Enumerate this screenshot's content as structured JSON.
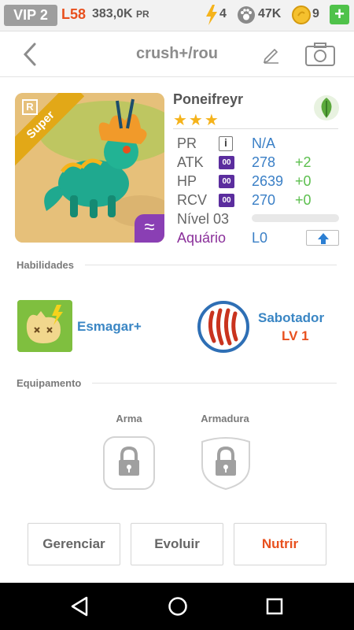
{
  "status_bar": {
    "vip": "VIP 2",
    "level": "L58",
    "pr_value": "383,0K",
    "pr_suffix": "PR",
    "energy": "4",
    "food": "47K",
    "coins": "9",
    "add_label": "+"
  },
  "header": {
    "title": "crush+/rou"
  },
  "monster": {
    "name": "Poneifreyr",
    "rarity_letter": "R",
    "tier": "Super",
    "stars": "★★★",
    "element_icon": "leaf-icon",
    "element_color": "#5aa83b",
    "stats": [
      {
        "label": "PR",
        "icon": "i",
        "value": "N/A",
        "bonus": ""
      },
      {
        "label": "ATK",
        "icon": "00",
        "value": "278",
        "bonus": "+2"
      },
      {
        "label": "HP",
        "icon": "00",
        "value": "2639",
        "bonus": "+0"
      },
      {
        "label": "RCV",
        "icon": "00",
        "value": "270",
        "bonus": "+0"
      }
    ],
    "level_label": "Nível 03",
    "aquario_label": "Aquário",
    "aquario_value": "L0"
  },
  "abilities": {
    "title": "Habilidades",
    "skill1": {
      "name": "Esmagar+"
    },
    "skill2": {
      "name": "Sabotador",
      "level": "LV 1"
    }
  },
  "equipment": {
    "title": "Equipamento",
    "weapon_label": "Arma",
    "armor_label": "Armadura"
  },
  "actions": {
    "manage": "Gerenciar",
    "evolve": "Evoluir",
    "feed": "Nutrir"
  },
  "colors": {
    "accent_orange": "#e8501e",
    "value_blue": "#3a7fc6",
    "bonus_green": "#5cbf4e",
    "aquario_purple": "#8a2f9a"
  }
}
